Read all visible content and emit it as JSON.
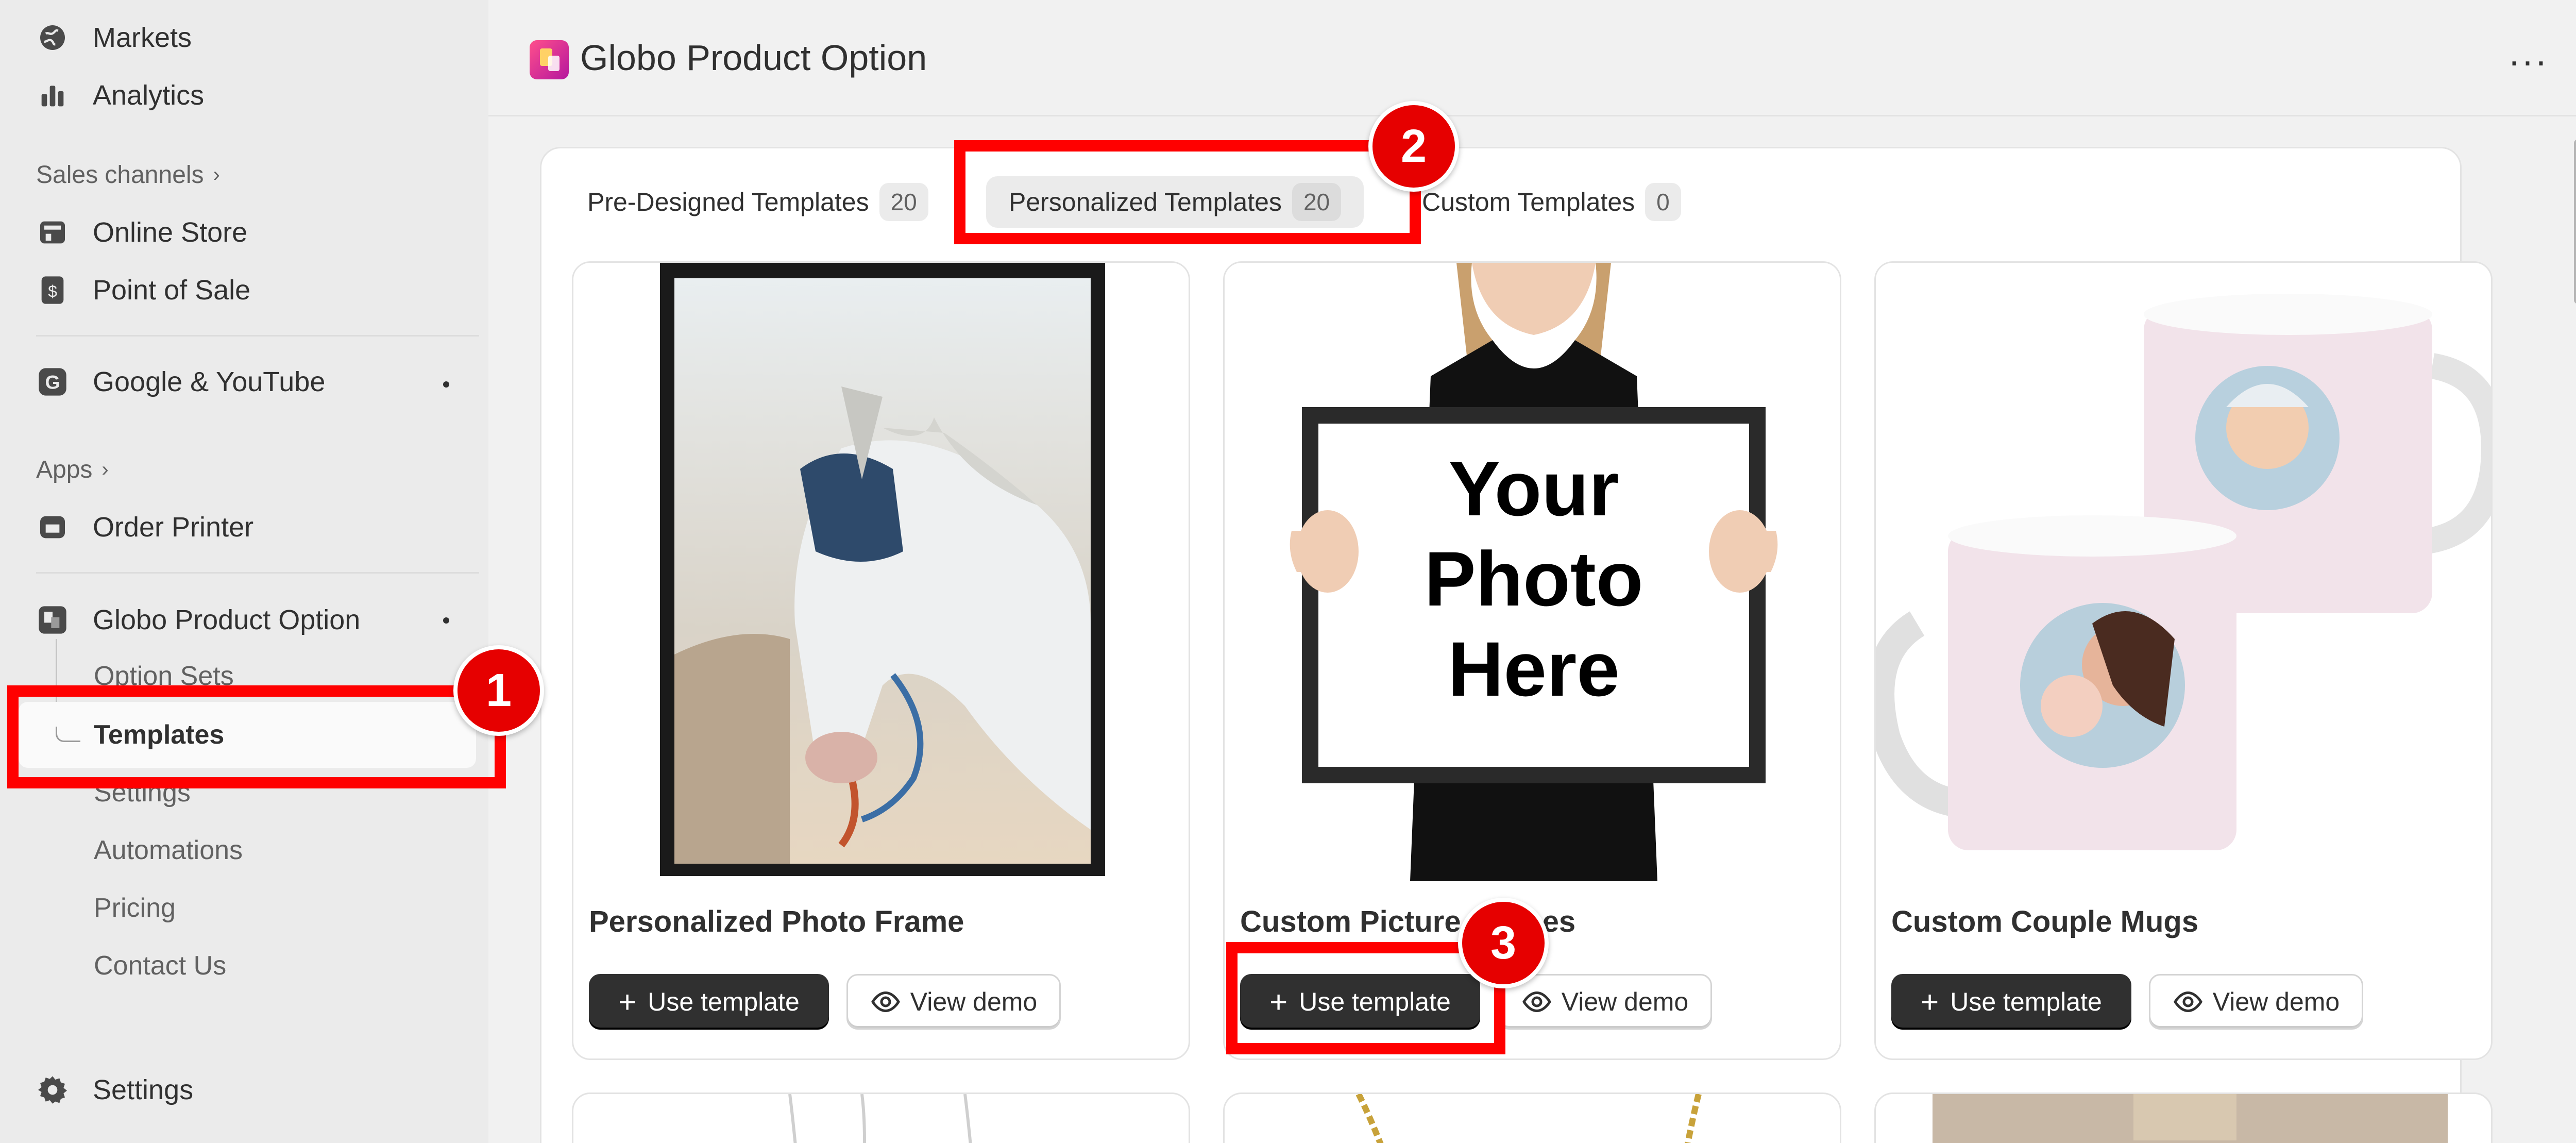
{
  "sidebar": {
    "items": {
      "markets": "Markets",
      "analytics": "Analytics",
      "online_store": "Online Store",
      "point_of_sale": "Point of Sale",
      "google_youtube": "Google & YouTube",
      "order_printer": "Order Printer",
      "globo": "Globo Product Option",
      "settings": "Settings"
    },
    "sales_channels": "Sales channels",
    "apps": "Apps",
    "chevron": "›",
    "subitems": {
      "option_sets": "Option Sets",
      "templates": "Templates",
      "settings": "Settings",
      "automations": "Automations",
      "pricing": "Pricing",
      "contact": "Contact Us"
    }
  },
  "header": {
    "title": "Globo Product Option",
    "more": "···"
  },
  "tabs": [
    {
      "label": "Pre-Designed Templates",
      "count": "20"
    },
    {
      "label": "Personalized Templates",
      "count": "20"
    },
    {
      "label": "Custom Templates",
      "count": "0"
    }
  ],
  "cards": [
    {
      "name": "Personalized Photo Frame",
      "use": "Use template",
      "demo": "View demo"
    },
    {
      "name": "Custom Picture Frames",
      "use": "Use template",
      "demo": "View demo"
    },
    {
      "name": "Custom Couple Mugs",
      "use": "Use template",
      "demo": "View demo"
    }
  ],
  "frame_text": [
    "Your",
    "Photo",
    "Here"
  ],
  "plus": "+",
  "badges": [
    "1",
    "2",
    "3"
  ],
  "colors": {
    "highlight": "#ff0000",
    "primary_button": "#303030"
  }
}
